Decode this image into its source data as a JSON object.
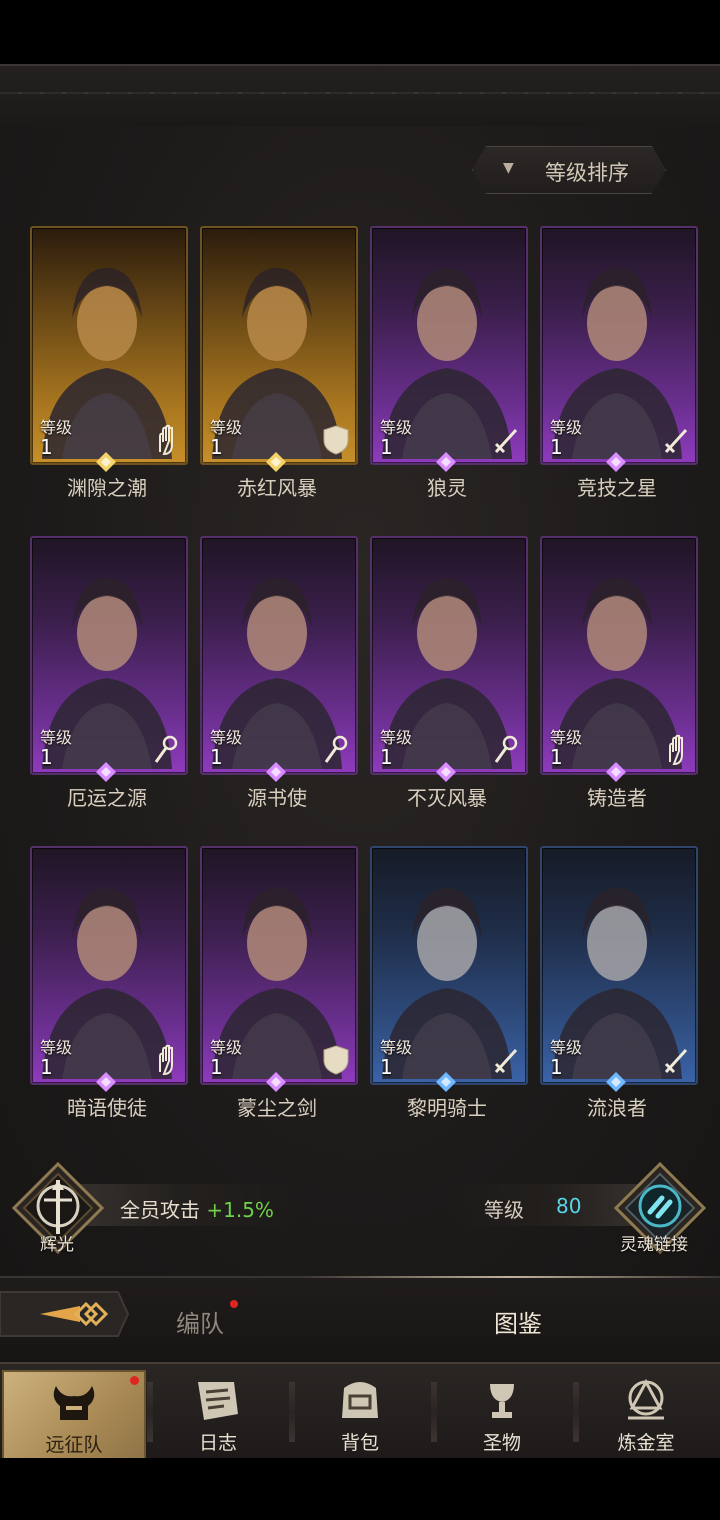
{
  "sort": {
    "label": "等级排序"
  },
  "heroes": [
    {
      "name": "渊隙之潮",
      "level_label": "等级",
      "level": "1",
      "rarity": "gold",
      "class_icon": "hand-icon"
    },
    {
      "name": "赤红风暴",
      "level_label": "等级",
      "level": "1",
      "rarity": "gold",
      "class_icon": "shield-icon"
    },
    {
      "name": "狼灵",
      "level_label": "等级",
      "level": "1",
      "rarity": "purple",
      "class_icon": "sword-icon"
    },
    {
      "name": "竞技之星",
      "level_label": "等级",
      "level": "1",
      "rarity": "purple",
      "class_icon": "sword-icon"
    },
    {
      "name": "厄运之源",
      "level_label": "等级",
      "level": "1",
      "rarity": "purple",
      "class_icon": "staff-icon"
    },
    {
      "name": "源书使",
      "level_label": "等级",
      "level": "1",
      "rarity": "purple",
      "class_icon": "staff-icon"
    },
    {
      "name": "不灭风暴",
      "level_label": "等级",
      "level": "1",
      "rarity": "purple",
      "class_icon": "staff-icon"
    },
    {
      "name": "铸造者",
      "level_label": "等级",
      "level": "1",
      "rarity": "purple",
      "class_icon": "hand-icon"
    },
    {
      "name": "暗语使徒",
      "level_label": "等级",
      "level": "1",
      "rarity": "purple",
      "class_icon": "hand-icon"
    },
    {
      "name": "蒙尘之剑",
      "level_label": "等级",
      "level": "1",
      "rarity": "purple",
      "class_icon": "shield-icon"
    },
    {
      "name": "黎明骑士",
      "level_label": "等级",
      "level": "1",
      "rarity": "blue",
      "class_icon": "sword-icon"
    },
    {
      "name": "流浪者",
      "level_label": "等级",
      "level": "1",
      "rarity": "blue",
      "class_icon": "sword-icon"
    }
  ],
  "bonus": {
    "radiance_label": "辉光",
    "attack_text": "全员攻击",
    "attack_value": "+1.5%",
    "level_text": "等级",
    "level_value": "80",
    "soul_label": "灵魂链接"
  },
  "tabs": {
    "formation": "编队",
    "codex": "图鉴"
  },
  "nav": [
    {
      "label": "远征队",
      "icon": "helmet-icon"
    },
    {
      "label": "日志",
      "icon": "scroll-icon"
    },
    {
      "label": "背包",
      "icon": "bag-icon"
    },
    {
      "label": "圣物",
      "icon": "chalice-icon"
    },
    {
      "label": "炼金室",
      "icon": "alchemy-icon"
    }
  ],
  "colors": {
    "gold": "#c68f2a",
    "purple": "#8e3bbc",
    "blue": "#3b63a8",
    "bonus_green": "#6fd04a",
    "level_cyan": "#59d4e6"
  }
}
